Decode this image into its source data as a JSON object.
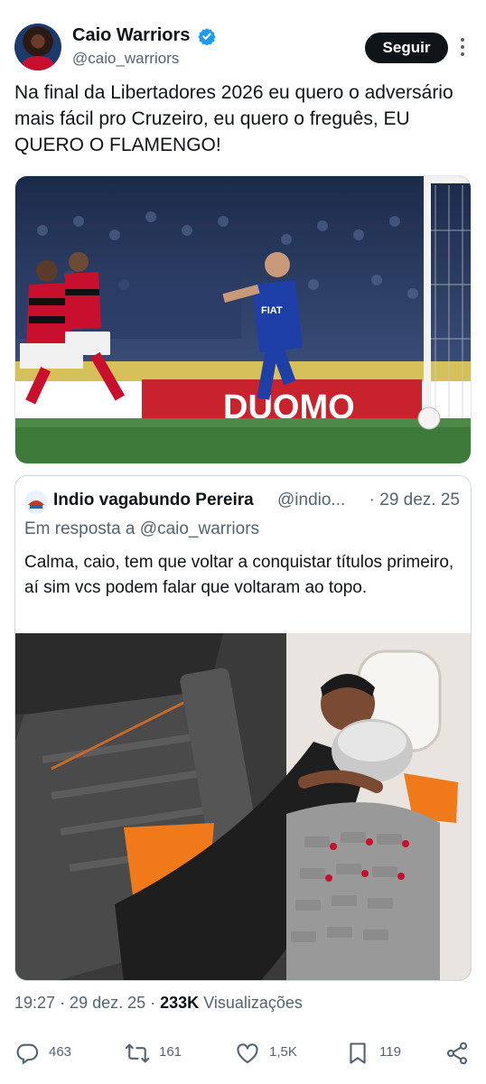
{
  "author": {
    "display_name": "Caio Warriors",
    "handle": "@caio_warriors",
    "verified": true
  },
  "follow_label": "Seguir",
  "tweet_text": "Na final da Libertadores 2026 eu quero o adversário mais fácil pro Cruzeiro, eu quero o freguês, EU QUERO O FLAMENGO!",
  "photo1": {
    "banner_text": "DUOMO",
    "shirt_text": "FIAT"
  },
  "quote": {
    "display_name": "Indio vagabundo Pereira",
    "handle": "@indio...",
    "date": "· 29 dez. 25",
    "reply_to": "Em resposta a @caio_warriors",
    "text": "Calma, caio, tem que voltar a conquistar títulos primeiro, aí sim vcs podem falar que voltaram ao topo."
  },
  "meta": {
    "time": "19:27",
    "date": "· 29 dez. 25 ·",
    "views_count": "233K",
    "views_label": "Visualizações"
  },
  "actions": {
    "replies": "463",
    "retweets": "161",
    "likes": "1,5K",
    "bookmarks": "119"
  },
  "colors": {
    "text": "#0f1419",
    "secondary": "#536471",
    "verified": "#1d9bf0",
    "border": "#cfd9de"
  },
  "icons": [
    "verified-badge-icon",
    "more-icon",
    "reply-icon",
    "retweet-icon",
    "like-icon",
    "bookmark-icon",
    "share-icon"
  ]
}
